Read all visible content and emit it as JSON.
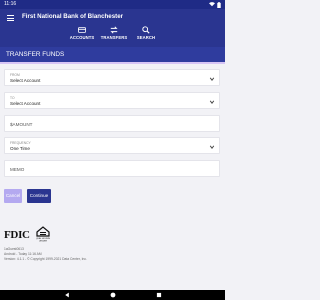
{
  "status_bar": {
    "time": "11:16"
  },
  "header": {
    "title": "First National Bank of Blanchester",
    "tabs": [
      {
        "label": "ACCOUNTS",
        "icon": "credit-card-icon"
      },
      {
        "label": "TRANSFERS",
        "icon": "transfer-arrows-icon"
      },
      {
        "label": "SEARCH",
        "icon": "search-icon"
      }
    ]
  },
  "page": {
    "title": "TRANSFER FUNDS"
  },
  "form": {
    "from": {
      "label": "FROM",
      "value": "Select Account"
    },
    "to": {
      "label": "TO",
      "value": "Select Account"
    },
    "amount": {
      "placeholder": "$AMOUNT"
    },
    "frequency": {
      "label": "FREQUENCY",
      "value": "One Time"
    },
    "memo": {
      "placeholder": "MEMO"
    }
  },
  "buttons": {
    "cancel": "Cancel",
    "continue": "Continue"
  },
  "footer": {
    "fdic_text": "FDIC",
    "ehl_text": "EQUAL HOUSING LENDER",
    "user_id": "1aGuest0613",
    "last_access": "Android - Today 11:16 AM",
    "version": "Version: 4.1.1 - © Copyright 1999-2021 Data Center, Inc."
  },
  "colors": {
    "header": "#2a3590",
    "status_bar": "#1f2b86",
    "accent_underline": "#d7c5f5",
    "cancel_button": "#b4a9f0",
    "continue_button": "#2a3590"
  }
}
